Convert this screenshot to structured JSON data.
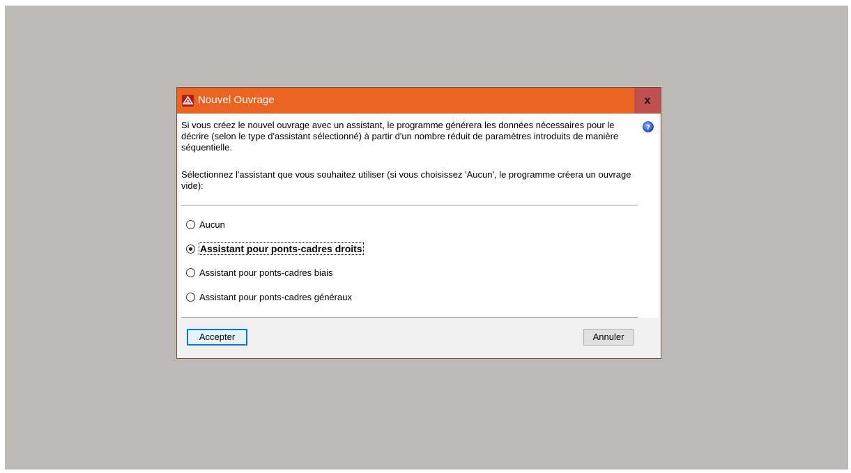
{
  "dialog": {
    "title": "Nouvel Ouvrage",
    "close_label": "x",
    "description": "Si vous créez le nouvel ouvrage avec un assistant, le programme générera les données nécessaires pour le décrire (selon le type d'assistant sélectionné) à partir d'un nombre réduit de paramètres introduits de manière séquentielle.",
    "instruction": "Sélectionnez l'assistant que vous souhaitez utiliser (si vous choisissez 'Aucun', le programme créera un ouvrage vide):",
    "options": [
      {
        "label": "Aucun",
        "selected": false
      },
      {
        "label": "Assistant pour ponts-cadres droits",
        "selected": true
      },
      {
        "label": "Assistant pour ponts-cadres biais",
        "selected": false
      },
      {
        "label": "Assistant pour ponts-cadres généraux",
        "selected": false
      }
    ],
    "accept_label": "Accepter",
    "cancel_label": "Annuler"
  },
  "icons": {
    "app": "app-logo-icon",
    "help": "help-icon",
    "close": "close-icon"
  },
  "colors": {
    "titlebar": "#ec6421",
    "close_button": "#c0504d",
    "backdrop": "#bcbab6",
    "help_icon": "#2a5bd7"
  }
}
